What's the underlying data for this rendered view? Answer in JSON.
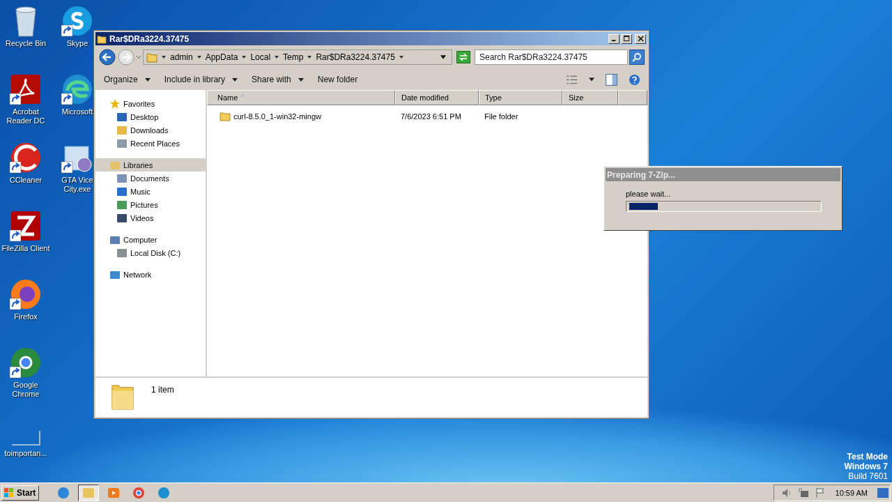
{
  "desktop": {
    "columns": [
      [
        {
          "label": "Recycle Bin",
          "kind": "recycle",
          "shortcut": false
        },
        {
          "label": "Acrobat Reader DC",
          "kind": "acrobat",
          "shortcut": true
        },
        {
          "label": "CCleaner",
          "kind": "ccleaner",
          "shortcut": true
        },
        {
          "label": "FileZilla Client",
          "kind": "filezilla",
          "shortcut": true
        },
        {
          "label": "Firefox",
          "kind": "firefox",
          "shortcut": true
        },
        {
          "label": "Google Chrome",
          "kind": "chrome",
          "shortcut": true
        },
        {
          "label": "toimportan...",
          "kind": "blank",
          "shortcut": false
        }
      ],
      [
        {
          "label": "Skype",
          "kind": "skype",
          "shortcut": true
        },
        {
          "label": "Microsoft",
          "kind": "edge",
          "shortcut": true
        },
        {
          "label": "GTA Vice City.exe",
          "kind": "installer",
          "shortcut": true
        }
      ]
    ],
    "os_notice": [
      "Test Mode",
      "Windows 7",
      "Build 7601"
    ]
  },
  "explorer": {
    "title": "Rar$DRa3224.37475",
    "crumbs": [
      "admin",
      "AppData",
      "Local",
      "Temp",
      "Rar$DRa3224.37475"
    ],
    "search": {
      "placeholder": "Search Rar$DRa3224.37475"
    },
    "toolbar": [
      {
        "label": "Organize",
        "dropdown": true
      },
      {
        "label": "Include in library",
        "dropdown": true
      },
      {
        "label": "Share with",
        "dropdown": true
      },
      {
        "label": "New folder",
        "dropdown": false
      }
    ],
    "nav": [
      {
        "label": "Favorites",
        "kind": "star",
        "selected": false,
        "children": [
          {
            "label": "Desktop",
            "kind": "desktop",
            "selected": false
          },
          {
            "label": "Downloads",
            "kind": "downloads",
            "selected": false
          },
          {
            "label": "Recent Places",
            "kind": "recent",
            "selected": false
          }
        ]
      },
      {
        "label": "Libraries",
        "kind": "library",
        "selected": true,
        "children": [
          {
            "label": "Documents",
            "kind": "documents",
            "selected": false
          },
          {
            "label": "Music",
            "kind": "music",
            "selected": false
          },
          {
            "label": "Pictures",
            "kind": "pictures",
            "selected": false
          },
          {
            "label": "Videos",
            "kind": "videos",
            "selected": false
          }
        ]
      },
      {
        "label": "Computer",
        "kind": "computer",
        "selected": false,
        "children": [
          {
            "label": "Local Disk (C:)",
            "kind": "disk",
            "selected": false
          }
        ]
      },
      {
        "label": "Network",
        "kind": "network",
        "selected": false
      }
    ],
    "columns": [
      {
        "label": "Name",
        "sorted": true
      },
      {
        "label": "Date modified",
        "sorted": false
      },
      {
        "label": "Type",
        "sorted": false
      },
      {
        "label": "Size",
        "sorted": false
      }
    ],
    "rows": [
      {
        "name": "curl-8.5.0_1-win32-mingw",
        "date": "7/6/2023 6:51 PM",
        "type": "File folder"
      }
    ],
    "status": "1 item"
  },
  "dialog": {
    "title": "Preparing 7-Zip...",
    "message": "please wait...",
    "level": 0.15
  },
  "taskbar": {
    "start": "Start",
    "apps": [
      {
        "kind": "ie",
        "selected": false
      },
      {
        "kind": "explorer",
        "selected": true
      },
      {
        "kind": "media",
        "selected": false
      },
      {
        "kind": "chrome",
        "selected": false
      },
      {
        "kind": "edge",
        "selected": false
      }
    ],
    "clock": "10:59 AM"
  }
}
